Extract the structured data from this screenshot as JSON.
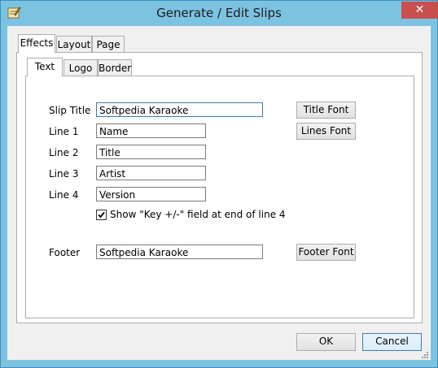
{
  "window": {
    "title": "Generate / Edit Slips",
    "close_glyph": "✕"
  },
  "outer_tabs": [
    {
      "label": "Effects",
      "active": true
    },
    {
      "label": "Layout",
      "active": false
    },
    {
      "label": "Page",
      "active": false
    }
  ],
  "inner_tabs": [
    {
      "label": "Text",
      "active": true
    },
    {
      "label": "Logo",
      "active": false
    },
    {
      "label": "Border",
      "active": false
    }
  ],
  "form": {
    "slip_title_label": "Slip Title",
    "slip_title_value": "Softpedia Karaoke",
    "line1_label": "Line 1",
    "line1_value": "Name",
    "line2_label": "Line 2",
    "line2_value": "Title",
    "line3_label": "Line 3",
    "line3_value": "Artist",
    "line4_label": "Line 4",
    "line4_value": "Version",
    "key_checkbox_label": "Show \"Key +/-\" field at end of line 4",
    "key_checkbox_checked": true,
    "footer_label": "Footer",
    "footer_value": "Softpedia Karaoke"
  },
  "buttons": {
    "title_font": "Title Font",
    "lines_font": "Lines Font",
    "footer_font": "Footer Font",
    "ok": "OK",
    "cancel": "Cancel"
  },
  "colors": {
    "titlebar": "#7cc3e2",
    "close": "#c7504d",
    "focus_border": "#3c7fb1"
  }
}
